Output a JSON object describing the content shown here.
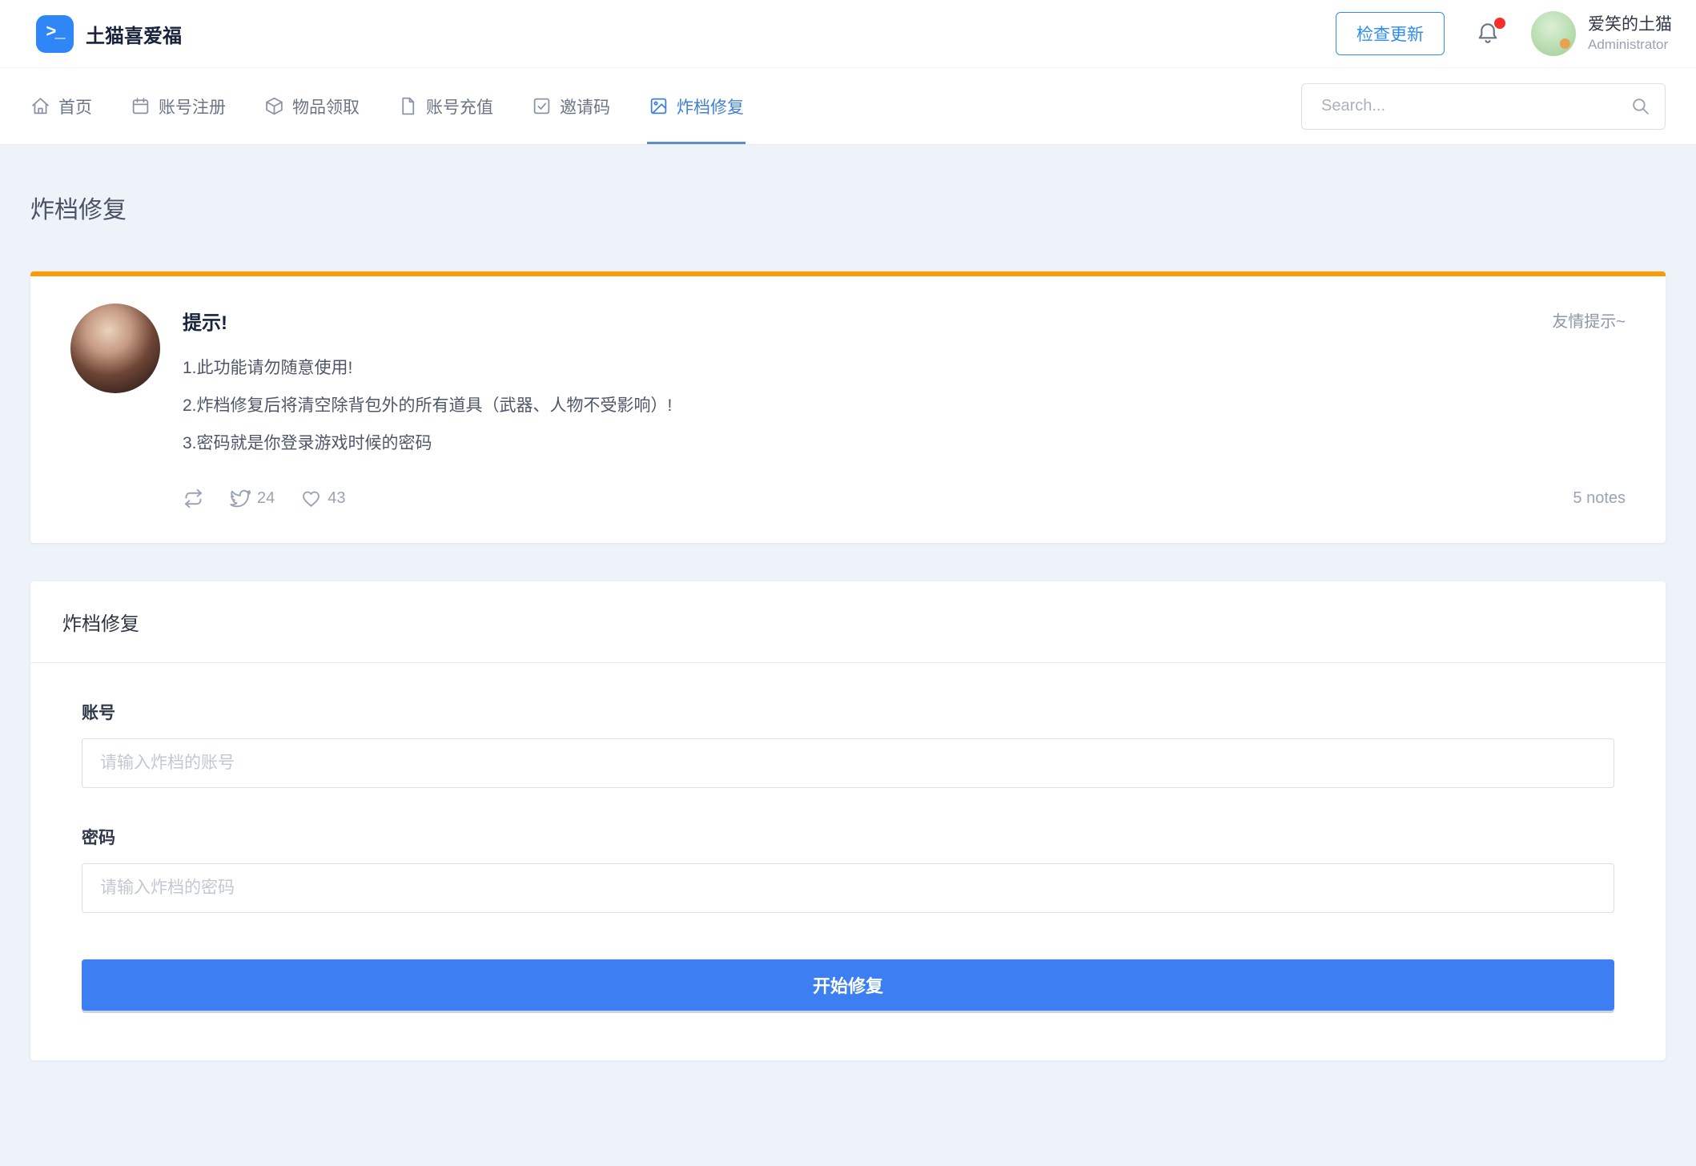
{
  "brand": {
    "name": "土猫喜爱福",
    "logo_glyph": ">_"
  },
  "header": {
    "check_update_label": "检查更新",
    "user": {
      "name": "爱笑的土猫",
      "role": "Administrator"
    }
  },
  "nav": {
    "items": [
      {
        "label": "首页",
        "icon": "home-icon",
        "active": false
      },
      {
        "label": "账号注册",
        "icon": "calendar-icon",
        "active": false
      },
      {
        "label": "物品领取",
        "icon": "cube-icon",
        "active": false
      },
      {
        "label": "账号充值",
        "icon": "file-icon",
        "active": false
      },
      {
        "label": "邀请码",
        "icon": "checkbox-icon",
        "active": false
      },
      {
        "label": "炸档修复",
        "icon": "image-icon",
        "active": true
      }
    ],
    "search_placeholder": "Search..."
  },
  "page": {
    "title": "炸档修复"
  },
  "notice": {
    "title": "提示!",
    "tag": "友情提示~",
    "lines": [
      "1.此功能请勿随意使用!",
      "2.炸档修复后将清空除背包外的所有道具（武器、人物不受影响）!",
      "3.密码就是你登录游戏时候的密码"
    ],
    "retweets": "24",
    "likes": "43",
    "notes": "5 notes"
  },
  "form": {
    "title": "炸档修复",
    "fields": [
      {
        "label": "账号",
        "placeholder": "请输入炸档的账号"
      },
      {
        "label": "密码",
        "placeholder": "请输入炸档的密码"
      }
    ],
    "submit_label": "开始修复"
  },
  "colors": {
    "primary": "#2d8cf0",
    "active_tab": "#3e7fd8",
    "button": "#3d7ff3",
    "warning_border": "#ff9900",
    "notification_dot": "#f3302a",
    "background": "#eef2f9"
  }
}
